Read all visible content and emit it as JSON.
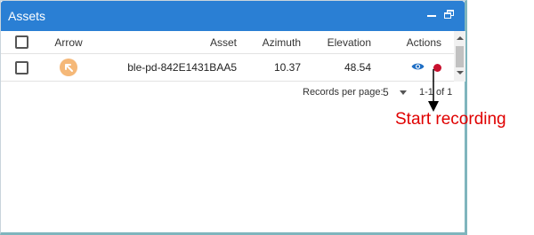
{
  "window": {
    "title": "Assets",
    "minimize_icon": "minimize-icon",
    "restore_icon": "restore-window-icon"
  },
  "table": {
    "headers": {
      "arrow": "Arrow",
      "asset": "Asset",
      "azimuth": "Azimuth",
      "elevation": "Elevation",
      "actions": "Actions"
    },
    "rows": [
      {
        "arrow_icon": "diagonal-arrow-up-left-icon",
        "arrow_color": "#f5b878",
        "asset": "ble-pd-842E1431BAA5",
        "azimuth": "10.37",
        "elevation": "48.54",
        "actions": [
          "view-eye-icon",
          "record-dot-icon"
        ]
      }
    ]
  },
  "pagination": {
    "records_per_page_label": "Records per page:",
    "records_per_page_value": "5",
    "range_text": "1-1 of 1"
  },
  "annotation": {
    "text": "Start recording",
    "color": "#e00000"
  },
  "colors": {
    "titlebar": "#2a7fd4",
    "record": "#c8102e",
    "eye": "#1f6fc5"
  }
}
